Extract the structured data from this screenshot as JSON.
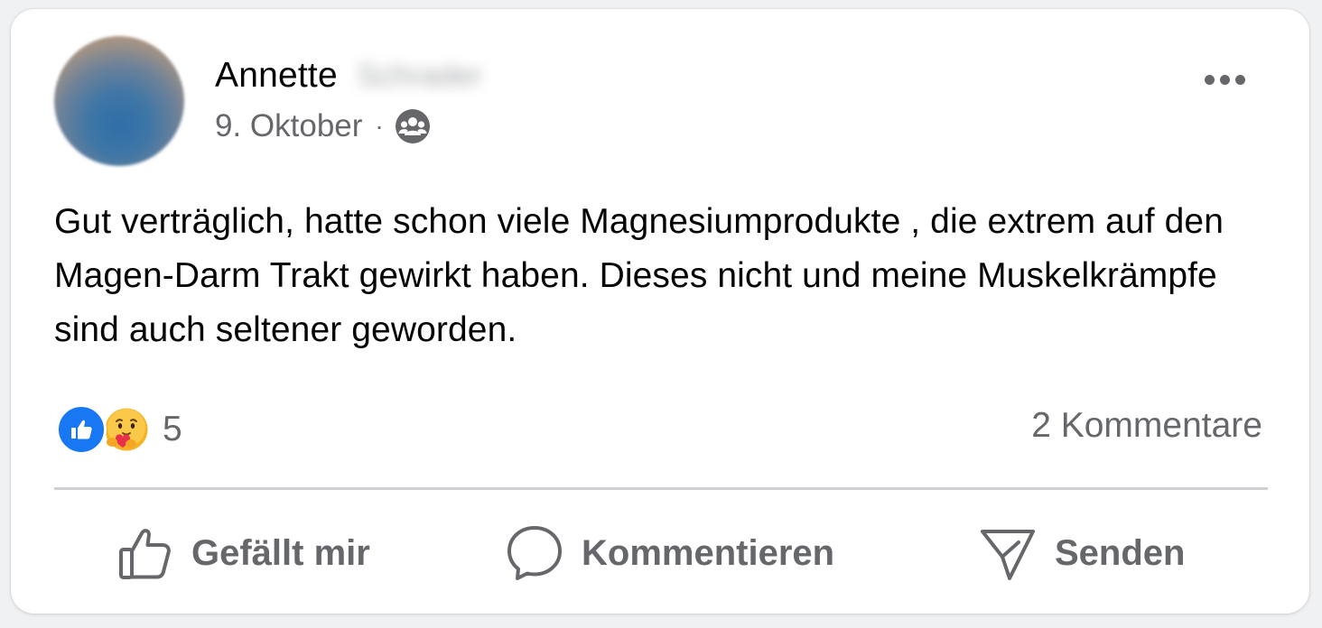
{
  "post": {
    "author_first_name": "Annette",
    "author_last_name_blurred": "Schrader",
    "date": "9. Oktober",
    "separator": "·",
    "audience_icon": "group-icon",
    "text": "Gut verträglich, hatte schon viele Magnesiumprodukte , die extrem auf den Magen-Darm Trakt gewirkt haben. Dieses nicht und meine Muskelkrämpfe sind auch seltener geworden."
  },
  "reactions": {
    "types": [
      "like-icon",
      "care-icon"
    ],
    "count": "5"
  },
  "comments": {
    "label": "2 Kommentare"
  },
  "actions": {
    "like_label": "Gefällt mir",
    "comment_label": "Kommentieren",
    "send_label": "Senden"
  },
  "colors": {
    "like_blue": "#1877f2",
    "secondary_text": "#65676b",
    "primary_text": "#050505",
    "divider": "#ced0d4"
  }
}
